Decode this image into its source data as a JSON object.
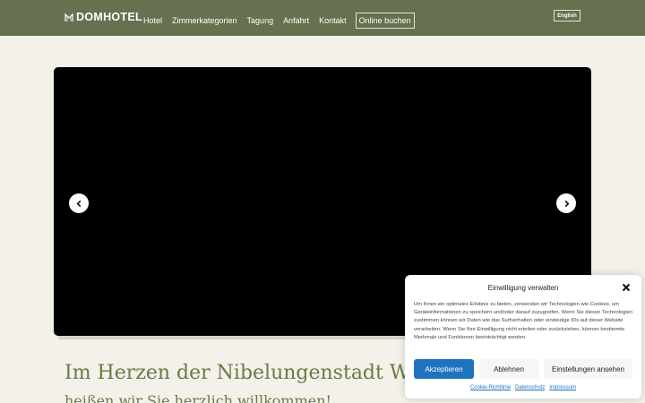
{
  "header": {
    "logo_text": "DOMHOTEL",
    "nav": [
      "Hotel",
      "Zimmerkategorien",
      "Tagung",
      "Anfahrt",
      "Kontakt"
    ],
    "book_label": "Online buchen",
    "lang_label": "English"
  },
  "main": {
    "heading": "Im Herzen der Nibelungenstadt Worms",
    "subheading": "heißen wir Sie herzlich willkommen!"
  },
  "consent": {
    "title": "Einwilligung verwalten",
    "text": "Um Ihnen ein optimales Erlebnis zu bieten, verwenden wir Technologien wie Cookies, um Geräteinformationen zu speichern und/oder darauf zuzugreifen. Wenn Sie diesen Technologien zustimmen können wir Daten wie das Surfverhalten oder eindeutige IDs auf dieser Website verarbeiten. Wenn Sie Ihre Einwilligung nicht erteilen oder zurückziehen, können bestimmte Merkmale und Funktionen beeinträchtigt werden.",
    "accept_label": "Akzeptieren",
    "deny_label": "Ablehnen",
    "settings_label": "Einstellungen ansehen",
    "links": [
      "Cookie-Richtlinie",
      "Datenschutz",
      "Impressum"
    ]
  },
  "colors": {
    "header_bg": "#65714f",
    "page_bg": "#f3f1ea",
    "heading": "#6b7a45",
    "accent_button": "#1e73be"
  },
  "icons": {
    "logo": "domhotel-logo-icon",
    "prev": "chevron-left-icon",
    "next": "chevron-right-icon",
    "close": "close-icon"
  }
}
